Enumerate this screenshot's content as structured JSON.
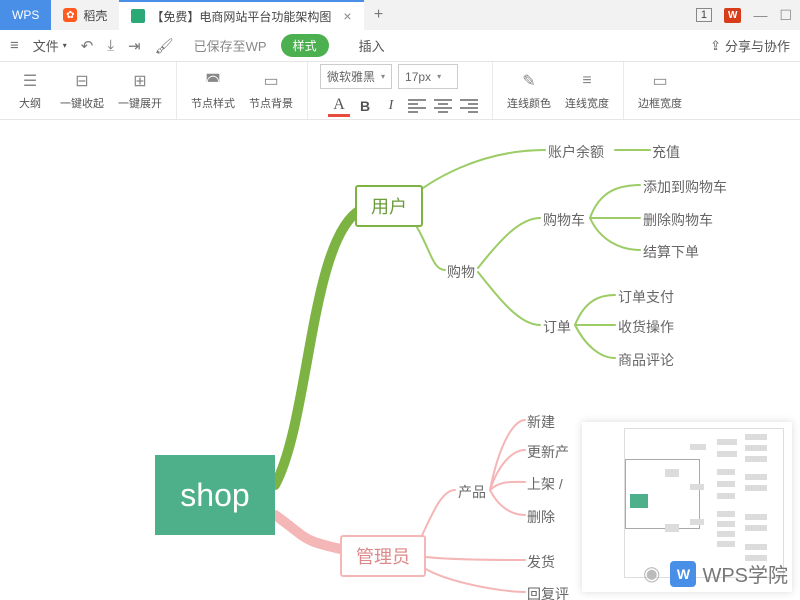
{
  "tabs": {
    "wps": "WPS",
    "daoke": "稻壳",
    "active": "【免费】电商网站平台功能架构图",
    "add": "+"
  },
  "titlebar": {
    "badge": "1",
    "wps": "W"
  },
  "menu": {
    "file": "文件",
    "saved": "已保存至WP",
    "style": "样式",
    "insert": "插入",
    "share": "分享与协作"
  },
  "toolbar": {
    "outline": "大纲",
    "collapse": "一键收起",
    "expand": "一键展开",
    "nodestyle": "节点样式",
    "nodebg": "节点背景",
    "font": "微软雅黑",
    "size": "17px",
    "linecolor": "连线颜色",
    "linewidth": "连线宽度",
    "borderwidth": "边框宽度",
    "bold": "B",
    "italic": "I"
  },
  "mind": {
    "root": "shop",
    "user": "用户",
    "admin": "管理员",
    "balance": "账户余额",
    "recharge": "充值",
    "shopping": "购物",
    "cart": "购物车",
    "addcart": "添加到购物车",
    "delcart": "删除购物车",
    "checkout": "结算下单",
    "order": "订单",
    "pay": "订单支付",
    "receive": "收货操作",
    "review": "商品评论",
    "product": "产品",
    "new": "新建",
    "update": "更新产",
    "shelf": "上架 /",
    "delete": "删除",
    "ship": "发货",
    "reply": "回复评"
  },
  "watermark": "WPS学院"
}
